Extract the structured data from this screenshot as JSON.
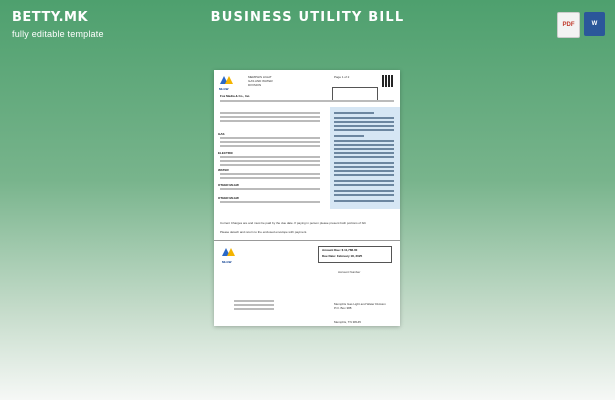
{
  "brand": {
    "logo": "BETTY.MK",
    "tagline": "fully editable template"
  },
  "headline": "BUSINESS UTILITY BILL",
  "file_icons": [
    {
      "label": "PDF",
      "icon": "pdf-file-icon"
    },
    {
      "label": "W",
      "icon": "word-file-icon"
    }
  ],
  "colors": {
    "bg_top": "#4ea06e",
    "bg_bottom": "#f6f8f6",
    "panel": "#d6e6f4"
  },
  "bill": {
    "company_lines": [
      "MEMPHIS LIGHT",
      "GAS AND WATER",
      "DIVISION"
    ],
    "company_abbr": "MLGW",
    "page": "Page 1 of 2",
    "customer": "Fox Media & Co., Inc.",
    "amount_due": "Amount Due: $ 11,786.00",
    "due_date": "Due Date: February 18, 2025",
    "notice": "Current Charges are and must be paid by the due date. If paying in person please present both portions of bill.",
    "customer_number": "Account Number",
    "remit_to": [
      "Memphis Gas Light and Water Division",
      "P.O. Box 388",
      "Memphis, TN 38145"
    ],
    "service_sections": [
      "GAS",
      "ELECTRIC",
      "WATER",
      "OTHER MLGW",
      "OTHER MLGW"
    ],
    "pay_terms": "Please detach and return to the enclosed envelope with payment."
  }
}
